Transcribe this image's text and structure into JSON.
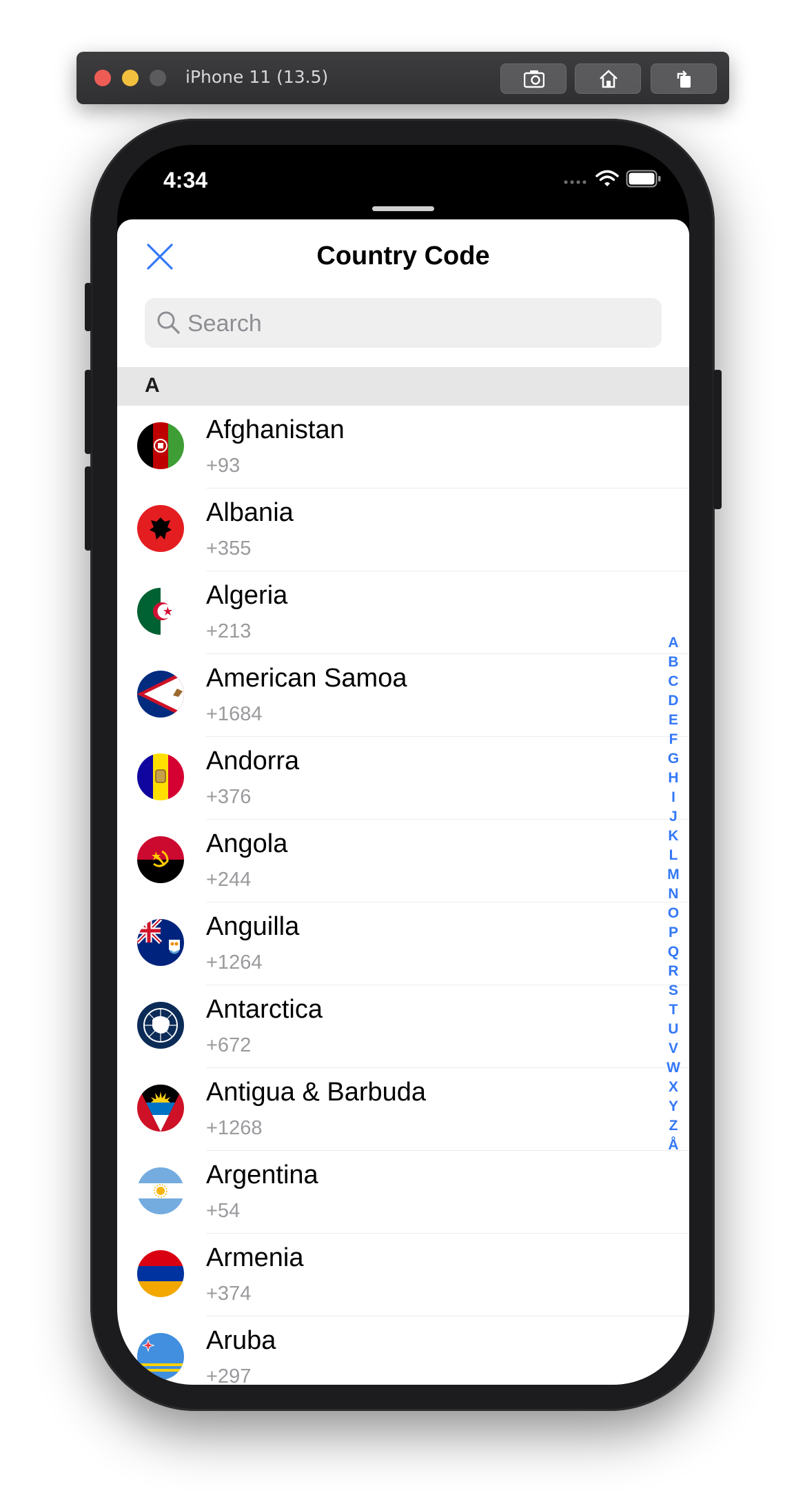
{
  "simulator": {
    "title": "iPhone 11 (13.5)",
    "buttons": [
      "screenshot-icon",
      "home-icon",
      "rotate-icon"
    ]
  },
  "status_bar": {
    "time": "4:34",
    "icons": [
      "signal-icon",
      "wifi-icon",
      "battery-icon"
    ]
  },
  "sheet": {
    "title": "Country Code",
    "close_icon": "close-icon",
    "search": {
      "placeholder": "Search",
      "value": ""
    },
    "section_header": "A",
    "countries": [
      {
        "name": "Afghanistan",
        "code": "+93"
      },
      {
        "name": "Albania",
        "code": "+355"
      },
      {
        "name": "Algeria",
        "code": "+213"
      },
      {
        "name": "American Samoa",
        "code": "+1684"
      },
      {
        "name": "Andorra",
        "code": "+376"
      },
      {
        "name": "Angola",
        "code": "+244"
      },
      {
        "name": "Anguilla",
        "code": "+1264"
      },
      {
        "name": "Antarctica",
        "code": "+672"
      },
      {
        "name": "Antigua & Barbuda",
        "code": "+1268"
      },
      {
        "name": "Argentina",
        "code": "+54"
      },
      {
        "name": "Armenia",
        "code": "+374"
      },
      {
        "name": "Aruba",
        "code": "+297"
      }
    ],
    "index_letters": [
      "A",
      "B",
      "C",
      "D",
      "E",
      "F",
      "G",
      "H",
      "I",
      "J",
      "K",
      "L",
      "M",
      "N",
      "O",
      "P",
      "Q",
      "R",
      "S",
      "T",
      "U",
      "V",
      "W",
      "X",
      "Y",
      "Z",
      "Å"
    ]
  },
  "colors": {
    "accent": "#3478f6",
    "secondary_text": "#9a9a9e",
    "section_bg": "#e6e6e7",
    "search_bg": "#efeff0"
  }
}
